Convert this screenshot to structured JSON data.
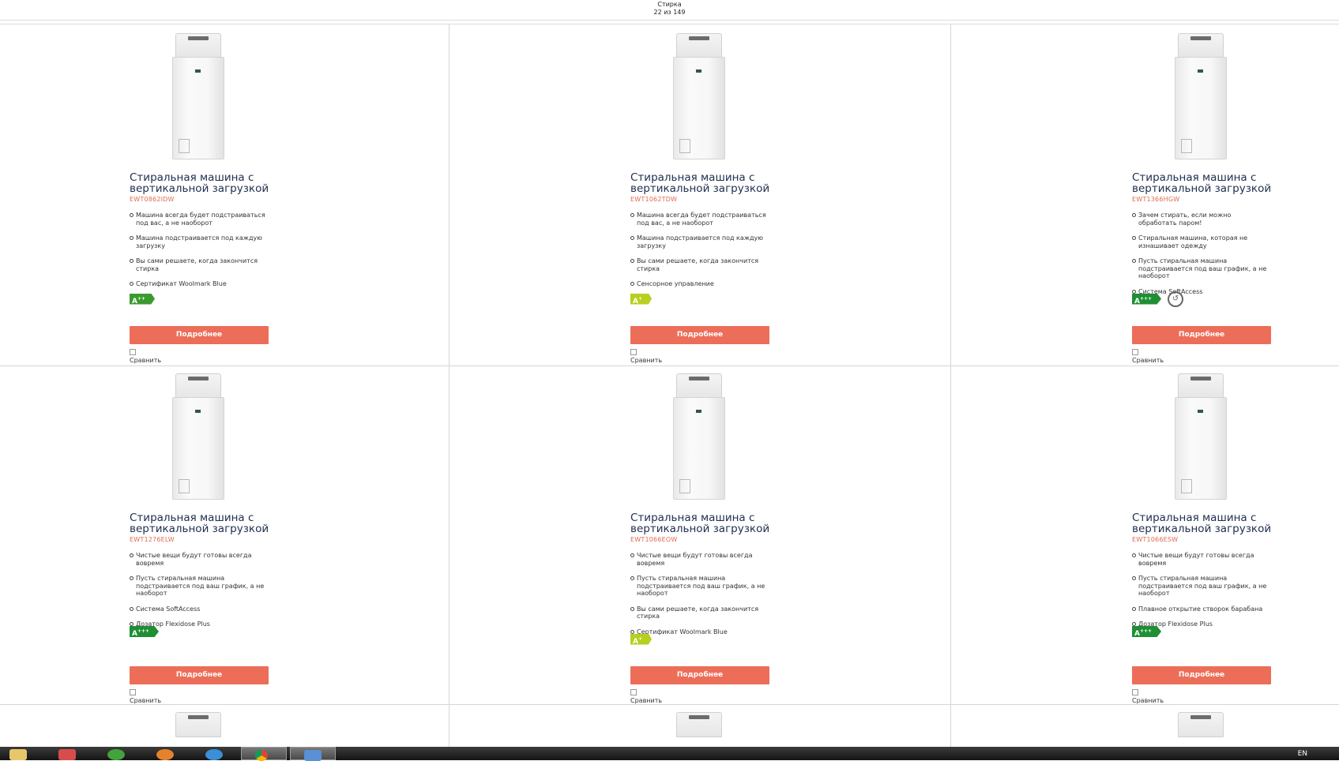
{
  "header": {
    "category": "Стирка",
    "counter": "22 из 149"
  },
  "products": [
    {
      "title": "Стиральная машина с вертикальной загрузкой",
      "model": "EWT0862IDW",
      "features": [
        "Машина всегда будет подстраиваться под вас, а не наоборот",
        "Машина подстраивается под каждую загрузку",
        "Вы сами решаете, когда закончится стирка",
        "Сертификат Woolmark Blue"
      ],
      "energy": "A",
      "energy_sup": "++",
      "energy_color": "#3a9a2e",
      "steam_icon": false,
      "button": "Подробнее",
      "compare": "Сравнить"
    },
    {
      "title": "Стиральная машина с вертикальной загрузкой",
      "model": "EWT1062TDW",
      "features": [
        "Машина всегда будет подстраиваться под вас, а не наоборот",
        "Машина подстраивается под каждую загрузку",
        "Вы сами решаете, когда закончится стирка",
        "Сенсорное управление"
      ],
      "energy": "A",
      "energy_sup": "+",
      "energy_color": "#b7cf1f",
      "steam_icon": false,
      "button": "Подробнее",
      "compare": "Сравнить"
    },
    {
      "title": "Стиральная машина с вертикальной загрузкой",
      "model": "EWT1366HGW",
      "features": [
        "Зачем стирать, если можно обработать паром!",
        "Стиральная машина, которая не изнашивает одежду",
        "Пусть стиральная машина подстраивается под ваш график, а не наоборот",
        "Система SoftAccess"
      ],
      "energy": "A",
      "energy_sup": "+++",
      "energy_color": "#1e8f34",
      "steam_icon": true,
      "button": "Подробнее",
      "compare": "Сравнить"
    },
    {
      "title": "Стиральная машина с вертикальной загрузкой",
      "model": "EWT1276ELW",
      "features": [
        "Чистые вещи будут готовы всегда вовремя",
        "Пусть стиральная машина подстраивается под ваш график, а не наоборот",
        "Система SoftAccess",
        "Дозатор Flexidose Plus"
      ],
      "energy": "A",
      "energy_sup": "+++",
      "energy_color": "#1e8f34",
      "steam_icon": false,
      "button": "Подробнее",
      "compare": "Сравнить"
    },
    {
      "title": "Стиральная машина с вертикальной загрузкой",
      "model": "EWT1066EOW",
      "features": [
        "Чистые вещи будут готовы всегда вовремя",
        "Пусть стиральная машина подстраивается под ваш график, а не наоборот",
        "Вы сами решаете, когда закончится стирка",
        "Сертификат Woolmark Blue"
      ],
      "energy": "A",
      "energy_sup": "+",
      "energy_color": "#b7cf1f",
      "steam_icon": false,
      "button": "Подробнее",
      "compare": "Сравнить"
    },
    {
      "title": "Стиральная машина с вертикальной загрузкой",
      "model": "EWT1066ESW",
      "features": [
        "Чистые вещи будут готовы всегда вовремя",
        "Пусть стиральная машина подстраивается под ваш график, а не наоборот",
        "Плавное открытие створок барабана",
        "Дозатор Flexidose Plus"
      ],
      "energy": "A",
      "energy_sup": "+++",
      "energy_color": "#1e8f34",
      "steam_icon": false,
      "button": "Подробнее",
      "compare": "Сравнить"
    }
  ],
  "taskbar": {
    "language": "EN"
  }
}
